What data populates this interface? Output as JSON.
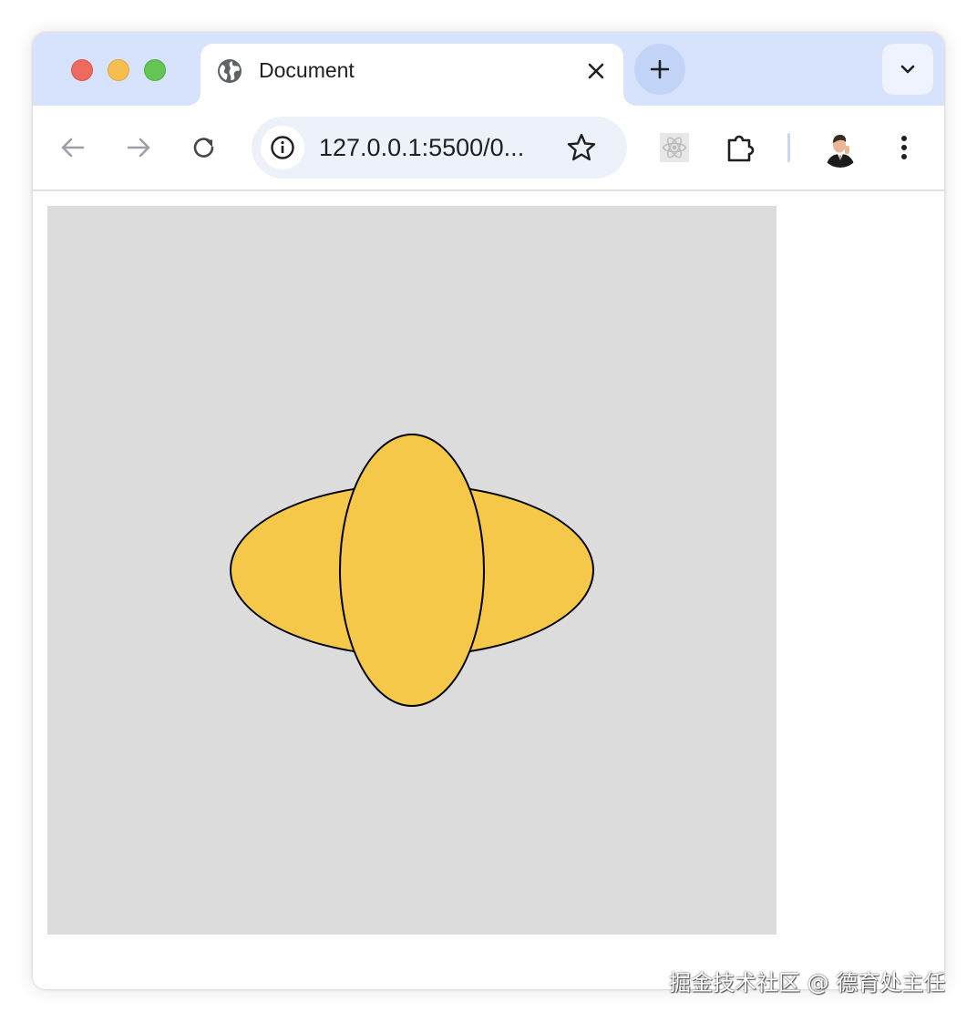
{
  "window": {
    "traffic_lights": {
      "close_color": "#ee6a5f",
      "minimize_color": "#f5be4f",
      "maximize_color": "#62c554"
    }
  },
  "tab": {
    "title": "Document",
    "favicon": "globe-icon",
    "close_icon": "close-icon"
  },
  "tabstrip": {
    "new_tab_icon": "plus-icon",
    "tab_search_icon": "chevron-down-icon"
  },
  "toolbar": {
    "back_icon": "arrow-left-icon",
    "forward_icon": "arrow-right-icon",
    "reload_icon": "reload-icon",
    "url": "127.0.0.1:5500/0...",
    "site_info_icon": "info-icon",
    "bookmark_icon": "star-icon",
    "extensions": [
      "react-devtools-icon",
      "puzzle-icon"
    ],
    "menu_icon": "kebab-menu-icon"
  },
  "page": {
    "background_color": "#dcdcdc",
    "shapes": [
      {
        "name": "horizontal-ellipse",
        "fill": "#f6c84a",
        "stroke": "#000000"
      },
      {
        "name": "vertical-ellipse",
        "fill": "#f6c84a",
        "stroke": "#000000"
      }
    ]
  },
  "colors": {
    "titlebar": "#d7e3fc",
    "omnibox": "#edf2fa",
    "accent_fill": "#f6c84a"
  },
  "watermark": "掘金技术社区 @ 德育处主任"
}
